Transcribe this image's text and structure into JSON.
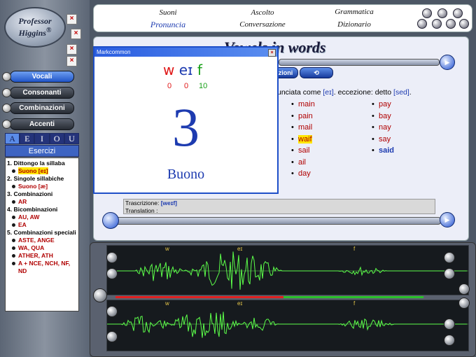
{
  "logo": {
    "line1": "Professor",
    "line2": "Higgins",
    "mark": "®"
  },
  "close_glyph": "×",
  "nav": {
    "buttons": [
      {
        "label": "Vocali",
        "active": true
      },
      {
        "label": "Consonanti",
        "active": false
      },
      {
        "label": "Combinazioni",
        "active": false
      },
      {
        "label": "Accenti",
        "active": false
      }
    ]
  },
  "vowels": [
    "A",
    "E",
    "I",
    "O",
    "U"
  ],
  "esercizi_label": "Esercizi",
  "exercises": [
    {
      "num": "1.",
      "title": "Dittongo la sillaba",
      "items": [
        "Suono [eɪ]"
      ]
    },
    {
      "num": "2.",
      "title": "Singole sillabiche",
      "items": [
        "Suono [æ]"
      ]
    },
    {
      "num": "3.",
      "title": "Combinazioni",
      "items": [
        "AR"
      ]
    },
    {
      "num": "4.",
      "title": "Bicombinazioni",
      "items": [
        "AU, AW",
        "EA"
      ]
    },
    {
      "num": "5.",
      "title": "Combinazioni speciali",
      "items": [
        "ASTE, ANGE",
        "WA, QUA",
        "ATHER, ATH",
        "A + NCE, NCH, NF, ND"
      ]
    }
  ],
  "top_menu": {
    "row1": [
      "Suoni",
      "Ascolto",
      "Grammatica"
    ],
    "row2": [
      "Pronuncia",
      "Conversazione",
      "Dizionario"
    ]
  },
  "lesson": {
    "title": "Vowels in words",
    "button_left": "zioni",
    "rule_prefix": "unciata come ",
    "rule_ipa1": "[eɪ]",
    "rule_mid": ". eccezione: detto ",
    "rule_ipa2": "[sed]",
    "rule_end": ".",
    "words_col1": [
      "main",
      "pain",
      "mail",
      "waif",
      "sail",
      "ail",
      "day"
    ],
    "words_col2": [
      "pay",
      "bay",
      "nay",
      "say",
      "said"
    ],
    "highlight_word": "waif",
    "blue_word": "said",
    "transcription_label": "Trascrizione:",
    "transcription_value": "[weɪf]",
    "translation_label": "Translation :",
    "translation_value": ""
  },
  "dialog": {
    "title": "Markcommon",
    "phonemes": [
      "w",
      "eɪ",
      "f"
    ],
    "phoneme_colors": [
      "#e01818",
      "#1d3bb0",
      "#17a017"
    ],
    "scores": [
      "0",
      "0",
      "10"
    ],
    "big_score": "3",
    "verdict": "Buono"
  },
  "wave": {
    "top_labels": [
      "w",
      "eɪ",
      "f"
    ],
    "bottom_labels": [
      "w",
      "eɪ",
      "f"
    ]
  },
  "colors": {
    "accent_blue": "#1d3bb0",
    "wave_green": "#5cff4a",
    "error_red": "#b00000",
    "highlight": "#ffe600"
  }
}
